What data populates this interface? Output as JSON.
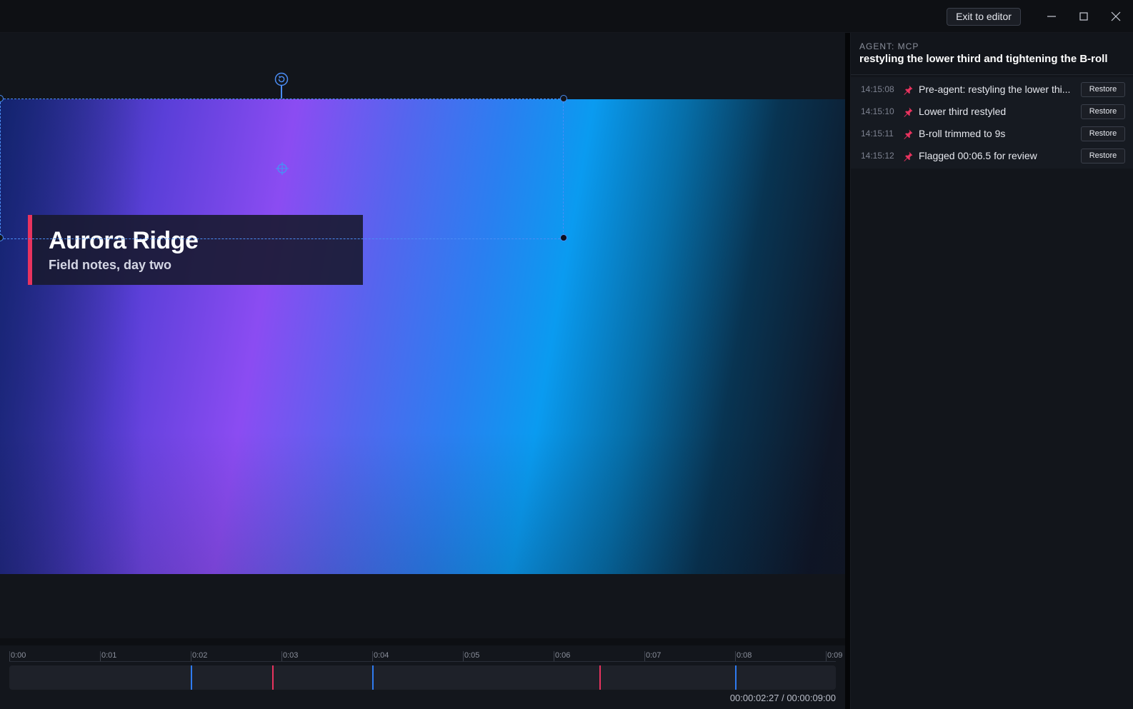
{
  "titlebar": {
    "exit_label": "Exit to editor"
  },
  "canvas": {
    "lower_third": {
      "title": "Aurora Ridge",
      "subtitle": "Field notes, day two",
      "accent_color": "#e8335e"
    },
    "selection_color": "#4b8df5"
  },
  "timeline": {
    "ticks": [
      "0:00",
      "0:01",
      "0:02",
      "0:03",
      "0:04",
      "0:05",
      "0:06",
      "0:07",
      "0:08",
      "0:09"
    ],
    "markers": [
      {
        "time_s": 2.0,
        "color": "#2f7bf0"
      },
      {
        "time_s": 2.9,
        "color": "#e8335e"
      },
      {
        "time_s": 4.0,
        "color": "#2f7bf0"
      },
      {
        "time_s": 6.5,
        "color": "#e8335e"
      },
      {
        "time_s": 8.0,
        "color": "#2f7bf0"
      }
    ],
    "duration_s": 9.0,
    "timecode": "00:00:02:27 / 00:00:09:00"
  },
  "panel": {
    "agent_label": "AGENT: MCP",
    "task": "restyling the lower third and tightening the B-roll",
    "snapshots": [
      {
        "time": "14:15:08",
        "text": "Pre-agent: restyling the lower thi...",
        "action": "Restore",
        "icon": "pin-icon"
      },
      {
        "time": "14:15:10",
        "text": "Lower third restyled",
        "action": "Restore",
        "icon": "pin-icon"
      },
      {
        "time": "14:15:11",
        "text": "B-roll trimmed to 9s",
        "action": "Restore",
        "icon": "pin-icon"
      },
      {
        "time": "14:15:12",
        "text": "Flagged 00:06.5 for review",
        "action": "Restore",
        "icon": "pin-icon"
      }
    ]
  }
}
